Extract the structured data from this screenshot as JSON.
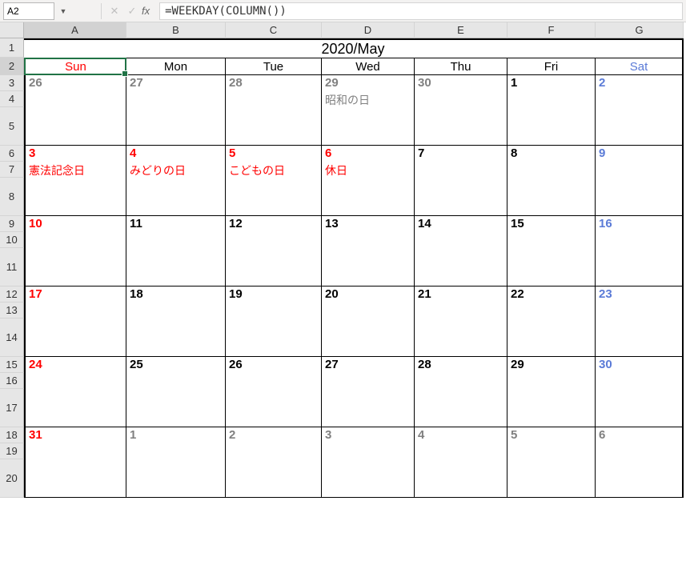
{
  "formulaBar": {
    "cellRef": "A2",
    "formula": "=WEEKDAY(COLUMN())"
  },
  "columns": [
    "A",
    "B",
    "C",
    "D",
    "E",
    "F",
    "G"
  ],
  "rows": [
    "1",
    "2",
    "3",
    "4",
    "5",
    "6",
    "7",
    "8",
    "9",
    "10",
    "11",
    "12",
    "13",
    "14",
    "15",
    "16",
    "17",
    "18",
    "19",
    "20"
  ],
  "activeCol": "A",
  "activeRow": "2",
  "title": "2020/May",
  "daysOfWeek": [
    {
      "label": "Sun",
      "color": "c-red",
      "selected": true
    },
    {
      "label": "Mon",
      "color": "c-black"
    },
    {
      "label": "Tue",
      "color": "c-black"
    },
    {
      "label": "Wed",
      "color": "c-black"
    },
    {
      "label": "Thu",
      "color": "c-black"
    },
    {
      "label": "Fri",
      "color": "c-black"
    },
    {
      "label": "Sat",
      "color": "c-blue"
    }
  ],
  "weeks": [
    [
      {
        "num": "26",
        "numColor": "c-gray",
        "event": ""
      },
      {
        "num": "27",
        "numColor": "c-gray",
        "event": ""
      },
      {
        "num": "28",
        "numColor": "c-gray",
        "event": ""
      },
      {
        "num": "29",
        "numColor": "c-gray",
        "event": "昭和の日",
        "eventColor": "c-gray"
      },
      {
        "num": "30",
        "numColor": "c-gray",
        "event": ""
      },
      {
        "num": "1",
        "numColor": "c-black",
        "event": ""
      },
      {
        "num": "2",
        "numColor": "c-blue",
        "event": ""
      }
    ],
    [
      {
        "num": "3",
        "numColor": "c-red",
        "event": "憲法記念日",
        "eventColor": "c-red"
      },
      {
        "num": "4",
        "numColor": "c-red",
        "event": "みどりの日",
        "eventColor": "c-red"
      },
      {
        "num": "5",
        "numColor": "c-red",
        "event": "こどもの日",
        "eventColor": "c-red"
      },
      {
        "num": "6",
        "numColor": "c-red",
        "event": "休日",
        "eventColor": "c-red"
      },
      {
        "num": "7",
        "numColor": "c-black",
        "event": ""
      },
      {
        "num": "8",
        "numColor": "c-black",
        "event": ""
      },
      {
        "num": "9",
        "numColor": "c-blue",
        "event": ""
      }
    ],
    [
      {
        "num": "10",
        "numColor": "c-red",
        "event": ""
      },
      {
        "num": "11",
        "numColor": "c-black",
        "event": ""
      },
      {
        "num": "12",
        "numColor": "c-black",
        "event": ""
      },
      {
        "num": "13",
        "numColor": "c-black",
        "event": ""
      },
      {
        "num": "14",
        "numColor": "c-black",
        "event": ""
      },
      {
        "num": "15",
        "numColor": "c-black",
        "event": ""
      },
      {
        "num": "16",
        "numColor": "c-blue",
        "event": ""
      }
    ],
    [
      {
        "num": "17",
        "numColor": "c-red",
        "event": ""
      },
      {
        "num": "18",
        "numColor": "c-black",
        "event": ""
      },
      {
        "num": "19",
        "numColor": "c-black",
        "event": ""
      },
      {
        "num": "20",
        "numColor": "c-black",
        "event": ""
      },
      {
        "num": "21",
        "numColor": "c-black",
        "event": ""
      },
      {
        "num": "22",
        "numColor": "c-black",
        "event": ""
      },
      {
        "num": "23",
        "numColor": "c-blue",
        "event": ""
      }
    ],
    [
      {
        "num": "24",
        "numColor": "c-red",
        "event": ""
      },
      {
        "num": "25",
        "numColor": "c-black",
        "event": ""
      },
      {
        "num": "26",
        "numColor": "c-black",
        "event": ""
      },
      {
        "num": "27",
        "numColor": "c-black",
        "event": ""
      },
      {
        "num": "28",
        "numColor": "c-black",
        "event": ""
      },
      {
        "num": "29",
        "numColor": "c-black",
        "event": ""
      },
      {
        "num": "30",
        "numColor": "c-blue",
        "event": ""
      }
    ],
    [
      {
        "num": "31",
        "numColor": "c-red",
        "event": ""
      },
      {
        "num": "1",
        "numColor": "c-gray",
        "event": ""
      },
      {
        "num": "2",
        "numColor": "c-gray",
        "event": ""
      },
      {
        "num": "3",
        "numColor": "c-gray",
        "event": ""
      },
      {
        "num": "4",
        "numColor": "c-gray",
        "event": ""
      },
      {
        "num": "5",
        "numColor": "c-gray",
        "event": ""
      },
      {
        "num": "6",
        "numColor": "c-gray",
        "event": ""
      }
    ]
  ],
  "rowHeights": {
    "title": 24,
    "dow": 22,
    "dayNum": 20,
    "dayEvent": 20,
    "daySpacer": 48
  }
}
